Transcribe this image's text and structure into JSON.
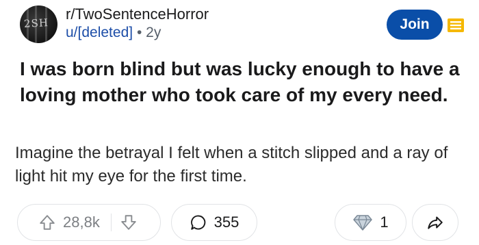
{
  "post": {
    "subreddit": "r/TwoSentenceHorror",
    "author": "u/[deleted]",
    "separator": "•",
    "age": "2y",
    "avatar_text": "2SH",
    "join_label": "Join",
    "title": "I was born blind but was lucky enough to have a loving mother who took care of my every need.",
    "body": "Imagine the betrayal I felt when a stitch slipped and a ray of light hit my eye for the first time.",
    "upvotes": "28,8k",
    "comments": "355",
    "awards": "1"
  },
  "colors": {
    "join_button": "#0a4ea8",
    "award_icon": "#f5b800",
    "username": "#1d4ea8"
  },
  "icons": [
    "upvote-icon",
    "downvote-icon",
    "comment-icon",
    "award-icon",
    "share-icon",
    "menu-icon"
  ]
}
